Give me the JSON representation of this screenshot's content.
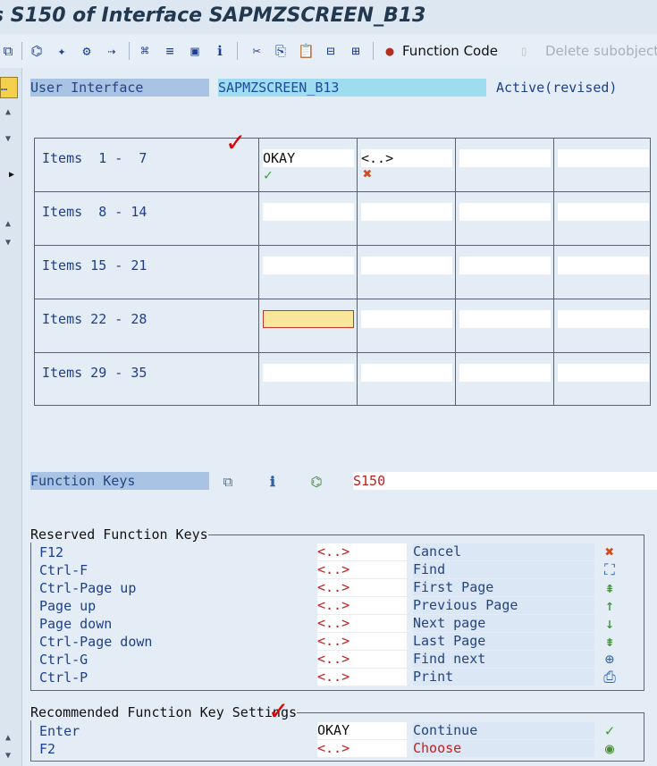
{
  "title": "s S150 of Interface SAPMZSCREEN_B13",
  "toolbar": {
    "function_code": "Function Code",
    "delete_subobject": "Delete subobject"
  },
  "header": {
    "user_interface_label": "User Interface",
    "program_name": "SAPMZSCREEN_B13",
    "status": "Active(revised)"
  },
  "items": {
    "rows": [
      "Items  1 -  7",
      "Items  8 - 14",
      "Items 15 - 21",
      "Items 22 - 28",
      "Items 29 - 35"
    ],
    "first_row": {
      "okay": "OKAY",
      "placeholder": "<..>"
    }
  },
  "function_keys": {
    "label": "Function Keys",
    "value": "S150"
  },
  "reserved": {
    "title": "Reserved Function Keys",
    "rows": [
      {
        "key": "F12",
        "code": "<..>",
        "text": "Cancel",
        "icon": "cancel-icon"
      },
      {
        "key": "Ctrl-F",
        "code": "<..>",
        "text": "Find",
        "icon": "find-icon"
      },
      {
        "key": "Ctrl-Page up",
        "code": "<..>",
        "text": "First Page",
        "icon": "first-page-icon"
      },
      {
        "key": "Page up",
        "code": "<..>",
        "text": "Previous Page",
        "icon": "previous-page-icon"
      },
      {
        "key": "Page down",
        "code": "<..>",
        "text": "Next page",
        "icon": "next-page-icon"
      },
      {
        "key": "Ctrl-Page down",
        "code": "<..>",
        "text": "Last Page",
        "icon": "last-page-icon"
      },
      {
        "key": "Ctrl-G",
        "code": "<..>",
        "text": "Find next",
        "icon": "find-next-icon"
      },
      {
        "key": "Ctrl-P",
        "code": "<..>",
        "text": "Print",
        "icon": "print-icon"
      }
    ]
  },
  "recommended": {
    "title": "Recommended Function Key Settings",
    "rows": [
      {
        "key": "Enter",
        "code": "OKAY",
        "text": "Continue",
        "icon": "continue-icon"
      },
      {
        "key": "F2",
        "code": "<..>",
        "text": "Choose",
        "icon": "choose-icon"
      }
    ]
  }
}
